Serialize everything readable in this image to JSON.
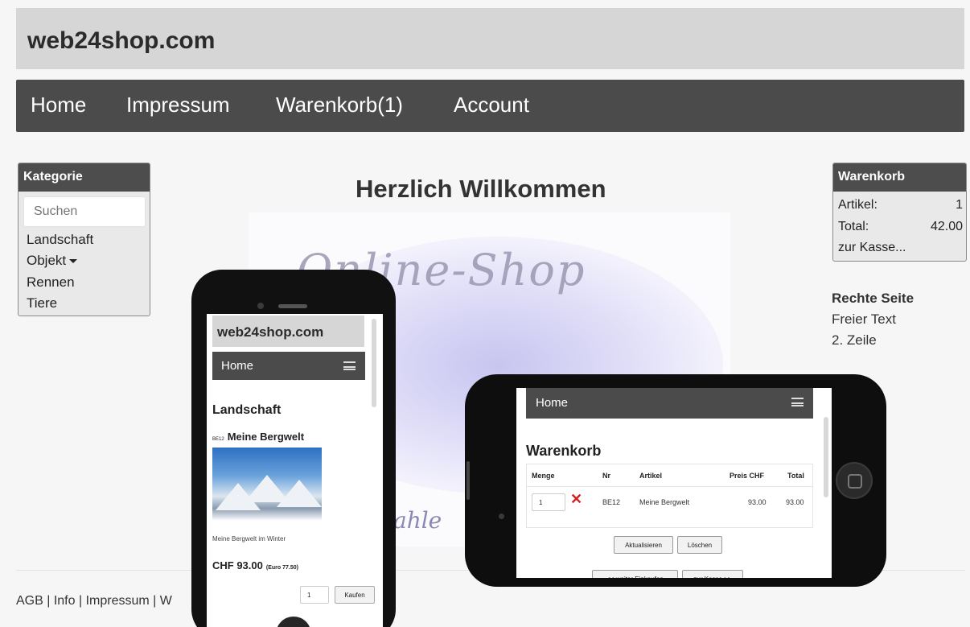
{
  "header": {
    "title": "web24shop.com"
  },
  "nav": {
    "items": [
      "Home",
      "Impressum",
      "Warenkorb(1)",
      "Account"
    ]
  },
  "left_panel": {
    "title": "Kategorie",
    "search_placeholder": "Suchen",
    "categories": [
      "Landschaft",
      "Objekt",
      "Rennen",
      "Tiere"
    ]
  },
  "main": {
    "heading": "Herzlich Willkommen",
    "banner_script": "Online-Shop",
    "banner_foot": "ahle"
  },
  "cart_panel": {
    "title": "Warenkorb",
    "items_label": "Artikel:",
    "items_value": "1",
    "total_label": "Total:",
    "total_value": "42.00",
    "checkout": "zur Kasse..."
  },
  "right_side": {
    "title": "Rechte Seite",
    "line1": "Freier Text",
    "line2": "2. Zeile"
  },
  "footer": {
    "text": "AGB | Info | Impressum | W"
  },
  "phone_portrait": {
    "title": "web24shop.com",
    "nav_home": "Home",
    "heading": "Landschaft",
    "product_code": "BE12",
    "product_name": "Meine Bergwelt",
    "caption": "Meine Bergwelt im Winter",
    "price": "CHF 93.00",
    "price_euro": "(Euro 77.50)",
    "qty": "1",
    "buy_label": "Kaufen"
  },
  "phone_landscape": {
    "nav_home": "Home",
    "heading": "Warenkorb",
    "columns": [
      "Menge",
      "Nr",
      "Artikel",
      "Preis CHF",
      "Total"
    ],
    "row": {
      "qty": "1",
      "nr": "BE12",
      "artikel": "Meine Bergwelt",
      "preis": "93.00",
      "total": "93.00"
    },
    "btn_update": "Aktualisieren",
    "btn_delete": "Löschen",
    "btn_continue": "<< weiter Einkaufen",
    "btn_checkout": "zur Kasse >>"
  }
}
